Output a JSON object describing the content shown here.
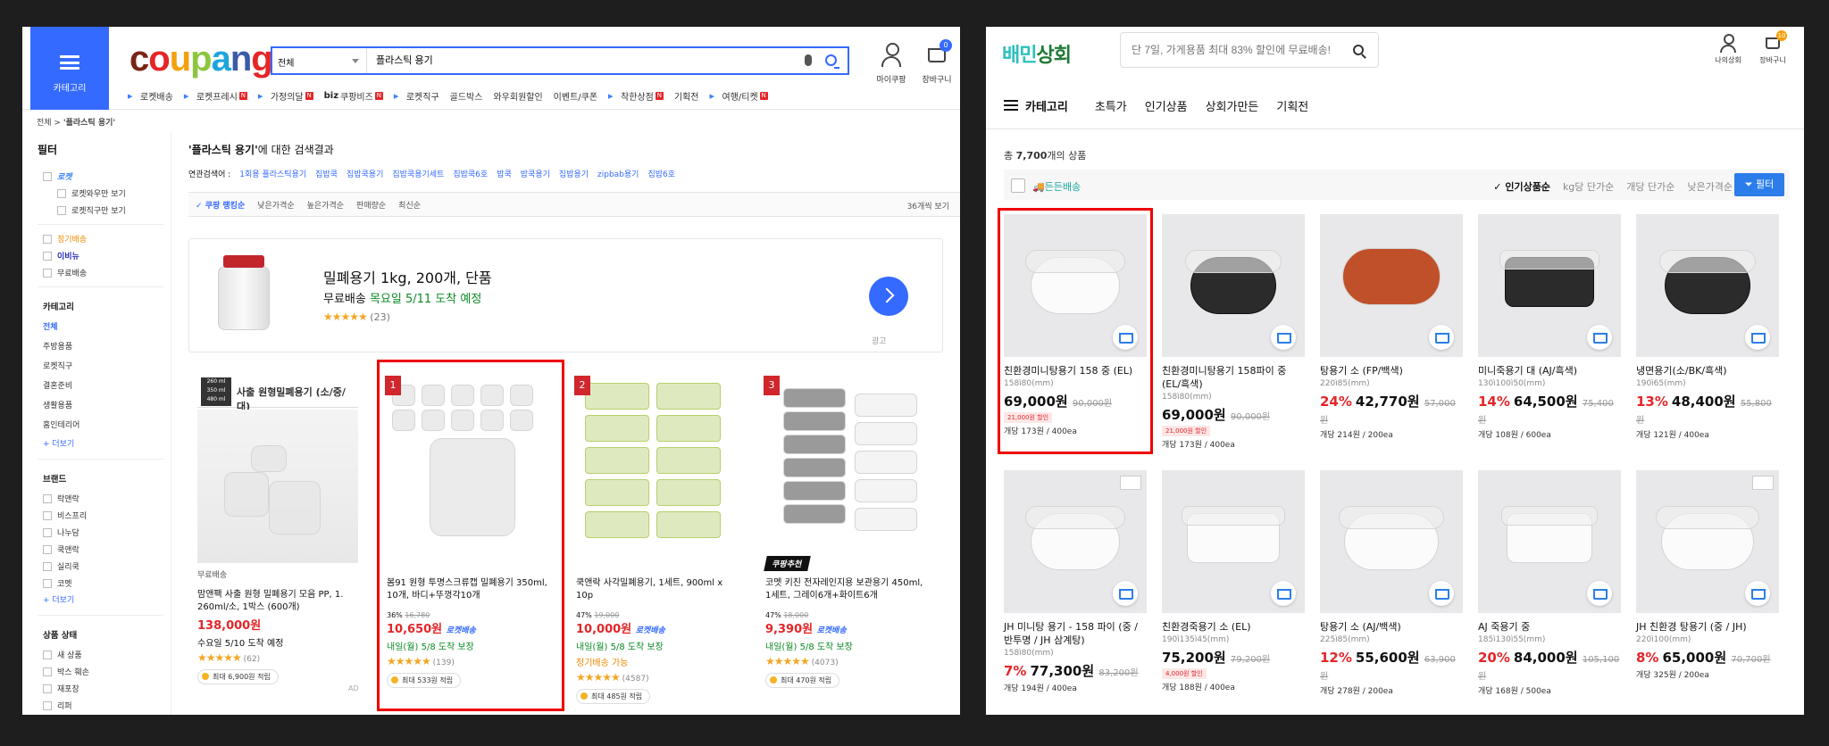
{
  "coupang": {
    "logo_letters": [
      "c",
      "o",
      "u",
      "p",
      "a",
      "n",
      "g"
    ],
    "category_label": "카테고리",
    "search": {
      "scope": "전체",
      "query": "플라스틱 용기"
    },
    "my_label": "마이쿠팡",
    "cart_label": "장바구니",
    "cart_count": "0",
    "nav": [
      {
        "label": "로켓배송",
        "icon": "rocket-icon",
        "n": false
      },
      {
        "label": "로켓프레시",
        "icon": "rocket-icon",
        "n": true
      },
      {
        "label": "가정의달",
        "icon": "gift-icon",
        "n": true
      },
      {
        "label": "쿠팡비즈",
        "prefix": "biz",
        "n": true
      },
      {
        "label": "로켓직구",
        "icon": "globe-icon",
        "n": false
      },
      {
        "label": "골드박스",
        "n": false
      },
      {
        "label": "와우회원할인",
        "n": false
      },
      {
        "label": "이벤트/쿠폰",
        "n": false
      },
      {
        "label": "착한상점",
        "icon": "shop-icon",
        "n": true
      },
      {
        "label": "기획전",
        "n": false
      },
      {
        "label": "여행/티켓",
        "icon": "plane-icon",
        "n": true
      }
    ],
    "n_badge": "N",
    "breadcrumb": [
      "전체",
      "'플라스틱 용기'"
    ],
    "filter": {
      "title": "필터",
      "rocket": "로켓",
      "rocket_wow": "로켓와우만 보기",
      "rocket_direct": "로켓직구만 보기",
      "regular": "정기배송",
      "ebeans": "이비뉴",
      "free_ship": "무료배송",
      "category_title": "카테고리",
      "categories": [
        "전체",
        "주방용품",
        "로켓직구",
        "결혼준비",
        "생활용품",
        "홈인테리어"
      ],
      "more": "+ 더보기",
      "brand_title": "브랜드",
      "brands": [
        "락앤락",
        "비스프리",
        "나누담",
        "쿡앤락",
        "실리쿡",
        "코멧"
      ],
      "status_title": "상품 상태",
      "status": [
        "새 상품",
        "박스 훼손",
        "재포장",
        "리퍼"
      ]
    },
    "result_quote": "'플라스틱 용기'",
    "result_suffix": "에 대한 검색결과",
    "related_label": "연관검색어 :",
    "related": [
      "1회용 플라스틱용기",
      "집밥쿡",
      "집밥쿡용기",
      "집밥쿡용기세트",
      "집밥쿡6호",
      "밥쿡",
      "밥쿡용기",
      "집밥용기",
      "zipbab용기",
      "집밥6호"
    ],
    "sort": [
      "쿠팡 랭킹순",
      "낮은가격순",
      "높은가격순",
      "판매량순",
      "최신순"
    ],
    "per_page": "36개씩 보기",
    "ad": {
      "title": "밀폐용기 1kg, 200개, 단품",
      "free": "무료배송",
      "delivery": "목요일 5/11 도착 예정",
      "stars": "★★★★★",
      "reviews": "(23)",
      "ad_label": "광고"
    },
    "products": [
      {
        "rank": "",
        "thumb_text": "사출 원형밀폐용기 (소/중/대)",
        "sizes": "260 ml\n350 ml\n480 ml",
        "free": "무료배송",
        "name": "맘앤팩 사출 원형 밀폐용기 모음 PP, 1. 260ml/소, 1박스 (600개)",
        "pct": "",
        "old": "",
        "price": "138,000원",
        "rocket": "",
        "delivery": "수요일 5/10 도착 예정",
        "dclass": "b",
        "stars": "★★★★★",
        "reviews": "(62)",
        "points": "최대 6,900원 적립",
        "recommend": ""
      },
      {
        "rank": "1",
        "name": "봄91 원형 투명스크류캡 밀폐용기 350ml, 10개, 바디+뚜껑각10개",
        "pct": "36%",
        "old": "16,780",
        "price": "10,650원",
        "rocket": "로켓배송",
        "delivery": "내일(월) 5/8 도착 보장",
        "dclass": "",
        "stars": "★★★★★",
        "reviews": "(139)",
        "points": "최대 533원 적립",
        "recommend": ""
      },
      {
        "rank": "2",
        "name": "쿡앤락 사각밀폐용기, 1세트, 900ml x 10p",
        "pct": "47%",
        "old": "19,000",
        "price": "10,000원",
        "rocket": "로켓배송",
        "delivery": "내일(월) 5/8 도착 보장",
        "dclass": "",
        "extra": "정기배송 가능",
        "stars": "★★★★★",
        "reviews": "(4587)",
        "points": "최대 485원 적립",
        "recommend": ""
      },
      {
        "rank": "3",
        "name": "코멧 키친 전자레인지용 보관용기 450ml, 1세트, 그레이6개+화이트6개",
        "pct": "47%",
        "old": "18,000",
        "price": "9,390원",
        "rocket": "로켓배송",
        "delivery": "내일(월) 5/8 도착 보장",
        "dclass": "",
        "stars": "★★★★★",
        "reviews": "(4073)",
        "points": "최대 470원 적립",
        "recommend": "쿠팡추천"
      }
    ],
    "ad_corner": "AD"
  },
  "baemin": {
    "logo_a": "배민",
    "logo_b": "상회",
    "search_placeholder": "단 7일, 가게용품 최대 83% 할인에 무료배송!",
    "my_label": "나의상회",
    "cart_label": "장바구니",
    "cart_count": "10",
    "menu_cat": "카테고리",
    "menu": [
      "초특가",
      "인기상품",
      "상회가만든",
      "기획전"
    ],
    "total_prefix": "총 ",
    "total_count": "7,700",
    "total_suffix": "개의 상품",
    "dd_label": "든든배송",
    "sorts": [
      "인기상품순",
      "kg당 단가순",
      "개당 단가순",
      "낮은가격순"
    ],
    "filter_btn": "필터",
    "products": [
      {
        "name": "친환경미니탕용기 158 중 (EL)",
        "size": "158ì80(mm)",
        "dc": "",
        "price": "69,000원",
        "old": "90,000원",
        "coupon": "21,000원 할인",
        "ea": "개당 173원 / 400ea"
      },
      {
        "name": "친환경미니탕용기 158파이 중 (EL/흑색)",
        "size": "158ì80(mm)",
        "dc": "",
        "price": "69,000원",
        "old": "90,000원",
        "coupon": "21,000원 할인",
        "ea": "개당 173원 / 400ea"
      },
      {
        "name": "탕용기 소 (FP/백색)",
        "size": "220ì85(mm)",
        "dc": "24%",
        "price": "42,770원",
        "old": "57,000원",
        "coupon": "",
        "ea": "개당 214원 / 200ea"
      },
      {
        "name": "미니죽용기 대 (AJ/흑색)",
        "size": "130ì100ì50(mm)",
        "dc": "14%",
        "price": "64,500원",
        "old": "75,400원",
        "coupon": "",
        "ea": "개당 108원 / 600ea"
      },
      {
        "name": "냉면용기(소/BK/흑색)",
        "size": "190ì65(mm)",
        "dc": "13%",
        "price": "48,400원",
        "old": "55,800원",
        "coupon": "",
        "ea": "개당 121원 / 400ea"
      },
      {
        "name": "JH 미니탕 용기 - 158 파이 (중 / 반투명 / JH 삼계탕)",
        "size": "158ì80(mm)",
        "dc": "7%",
        "price": "77,300원",
        "old": "83,200원",
        "coupon": "",
        "ea": "개당 194원 / 400ea"
      },
      {
        "name": "친환경죽용기 소 (EL)",
        "size": "190ì135ì45(mm)",
        "dc": "",
        "price": "75,200원",
        "old": "79,200원",
        "coupon": "4,000원 할인",
        "ea": "개당 188원 / 400ea"
      },
      {
        "name": "탕용기 소 (AJ/백색)",
        "size": "225ì85(mm)",
        "dc": "12%",
        "price": "55,600원",
        "old": "63,900원",
        "coupon": "",
        "ea": "개당 278원 / 200ea"
      },
      {
        "name": "AJ 죽용기 중",
        "size": "185ì130ì55(mm)",
        "dc": "20%",
        "price": "84,000원",
        "old": "105,100원",
        "coupon": "",
        "ea": "개당 168원 / 500ea"
      },
      {
        "name": "JH 친환경 탕용기 (중 / JH)",
        "size": "220ì100(mm)",
        "dc": "8%",
        "price": "65,000원",
        "old": "70,700원",
        "coupon": "",
        "ea": "개당 325원 / 200ea"
      }
    ]
  }
}
